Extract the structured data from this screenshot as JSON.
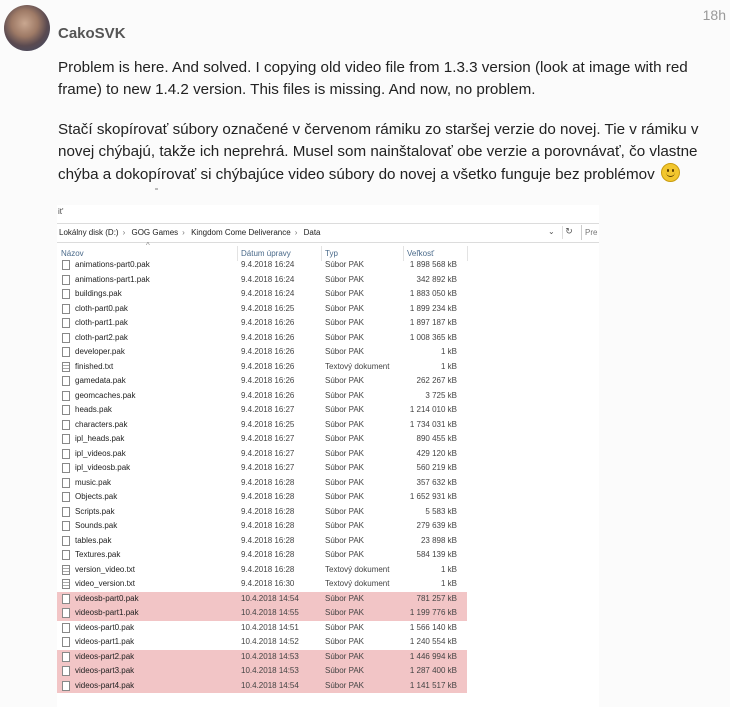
{
  "post": {
    "username": "CakoSVK",
    "time": "18h",
    "paragraph_en": "Problem is here. And solved. I copying old video file from 1.3.3 version (look at image with red frame) to new 1.4.2 version. This files is missing. And now, no problem.",
    "paragraph_sk": "Stačí skopírovať súbory označené v červenom rámiku zo staršej verzie do novej. Tie v rámiku v novej chýbajú, takže ich neprehrá. Musel som nainštalovať obe verzie a porovnávať, čo vlastne chýba a dokopírovať si chýbajúce video súbory do novej a všetko funguje bez problémov",
    "emoji": "smiley-emoji"
  },
  "explorer": {
    "top_fragment": "it'",
    "path": [
      "Lokálny disk (D:)",
      "GOG Games",
      "Kingdom Come Deliverance",
      "Data"
    ],
    "search_placeholder": "Pre",
    "columns": {
      "name": "Názov",
      "date": "Dátum úpravy",
      "type": "Typ",
      "size": "Veľkosť"
    },
    "highlight_color": "#f2c5c6",
    "files": [
      {
        "name": "animations-part0.pak",
        "date": "9.4.2018 16:24",
        "type": "Súbor PAK",
        "size": "1 898 568 kB",
        "icon": "file-icon",
        "highlighted": false
      },
      {
        "name": "animations-part1.pak",
        "date": "9.4.2018 16:24",
        "type": "Súbor PAK",
        "size": "342 892 kB",
        "icon": "file-icon",
        "highlighted": false
      },
      {
        "name": "buildings.pak",
        "date": "9.4.2018 16:24",
        "type": "Súbor PAK",
        "size": "1 883 050 kB",
        "icon": "file-icon",
        "highlighted": false
      },
      {
        "name": "cloth-part0.pak",
        "date": "9.4.2018 16:25",
        "type": "Súbor PAK",
        "size": "1 899 234 kB",
        "icon": "file-icon",
        "highlighted": false
      },
      {
        "name": "cloth-part1.pak",
        "date": "9.4.2018 16:26",
        "type": "Súbor PAK",
        "size": "1 897 187 kB",
        "icon": "file-icon",
        "highlighted": false
      },
      {
        "name": "cloth-part2.pak",
        "date": "9.4.2018 16:26",
        "type": "Súbor PAK",
        "size": "1 008 365 kB",
        "icon": "file-icon",
        "highlighted": false
      },
      {
        "name": "developer.pak",
        "date": "9.4.2018 16:26",
        "type": "Súbor PAK",
        "size": "1 kB",
        "icon": "file-icon",
        "highlighted": false
      },
      {
        "name": "finished.txt",
        "date": "9.4.2018 16:26",
        "type": "Textový dokument",
        "size": "1 kB",
        "icon": "text-file-icon",
        "highlighted": false
      },
      {
        "name": "gamedata.pak",
        "date": "9.4.2018 16:26",
        "type": "Súbor PAK",
        "size": "262 267 kB",
        "icon": "file-icon",
        "highlighted": false
      },
      {
        "name": "geomcaches.pak",
        "date": "9.4.2018 16:26",
        "type": "Súbor PAK",
        "size": "3 725 kB",
        "icon": "file-icon",
        "highlighted": false
      },
      {
        "name": "heads.pak",
        "date": "9.4.2018 16:27",
        "type": "Súbor PAK",
        "size": "1 214 010 kB",
        "icon": "file-icon",
        "highlighted": false
      },
      {
        "name": "characters.pak",
        "date": "9.4.2018 16:25",
        "type": "Súbor PAK",
        "size": "1 734 031 kB",
        "icon": "file-icon",
        "highlighted": false
      },
      {
        "name": "ipl_heads.pak",
        "date": "9.4.2018 16:27",
        "type": "Súbor PAK",
        "size": "890 455 kB",
        "icon": "file-icon",
        "highlighted": false
      },
      {
        "name": "ipl_videos.pak",
        "date": "9.4.2018 16:27",
        "type": "Súbor PAK",
        "size": "429 120 kB",
        "icon": "file-icon",
        "highlighted": false
      },
      {
        "name": "ipl_videosb.pak",
        "date": "9.4.2018 16:27",
        "type": "Súbor PAK",
        "size": "560 219 kB",
        "icon": "file-icon",
        "highlighted": false
      },
      {
        "name": "music.pak",
        "date": "9.4.2018 16:28",
        "type": "Súbor PAK",
        "size": "357 632 kB",
        "icon": "file-icon",
        "highlighted": false
      },
      {
        "name": "Objects.pak",
        "date": "9.4.2018 16:28",
        "type": "Súbor PAK",
        "size": "1 652 931 kB",
        "icon": "file-icon",
        "highlighted": false
      },
      {
        "name": "Scripts.pak",
        "date": "9.4.2018 16:28",
        "type": "Súbor PAK",
        "size": "5 583 kB",
        "icon": "file-icon",
        "highlighted": false
      },
      {
        "name": "Sounds.pak",
        "date": "9.4.2018 16:28",
        "type": "Súbor PAK",
        "size": "279 639 kB",
        "icon": "file-icon",
        "highlighted": false
      },
      {
        "name": "tables.pak",
        "date": "9.4.2018 16:28",
        "type": "Súbor PAK",
        "size": "23 898 kB",
        "icon": "file-icon",
        "highlighted": false
      },
      {
        "name": "Textures.pak",
        "date": "9.4.2018 16:28",
        "type": "Súbor PAK",
        "size": "584 139 kB",
        "icon": "file-icon",
        "highlighted": false
      },
      {
        "name": "version_video.txt",
        "date": "9.4.2018 16:28",
        "type": "Textový dokument",
        "size": "1 kB",
        "icon": "text-file-icon",
        "highlighted": false
      },
      {
        "name": "video_version.txt",
        "date": "9.4.2018 16:30",
        "type": "Textový dokument",
        "size": "1 kB",
        "icon": "text-file-icon",
        "highlighted": false
      },
      {
        "name": "videosb-part0.pak",
        "date": "10.4.2018 14:54",
        "type": "Súbor PAK",
        "size": "781 257 kB",
        "icon": "file-icon",
        "highlighted": true
      },
      {
        "name": "videosb-part1.pak",
        "date": "10.4.2018 14:55",
        "type": "Súbor PAK",
        "size": "1 199 776 kB",
        "icon": "file-icon",
        "highlighted": true
      },
      {
        "name": "videos-part0.pak",
        "date": "10.4.2018 14:51",
        "type": "Súbor PAK",
        "size": "1 566 140 kB",
        "icon": "file-icon",
        "highlighted": false
      },
      {
        "name": "videos-part1.pak",
        "date": "10.4.2018 14:52",
        "type": "Súbor PAK",
        "size": "1 240 554 kB",
        "icon": "file-icon",
        "highlighted": false
      },
      {
        "name": "videos-part2.pak",
        "date": "10.4.2018 14:53",
        "type": "Súbor PAK",
        "size": "1 446 994 kB",
        "icon": "file-icon",
        "highlighted": true
      },
      {
        "name": "videos-part3.pak",
        "date": "10.4.2018 14:53",
        "type": "Súbor PAK",
        "size": "1 287 400 kB",
        "icon": "file-icon",
        "highlighted": true
      },
      {
        "name": "videos-part4.pak",
        "date": "10.4.2018 14:54",
        "type": "Súbor PAK",
        "size": "1 141 517 kB",
        "icon": "file-icon",
        "highlighted": true
      }
    ]
  }
}
